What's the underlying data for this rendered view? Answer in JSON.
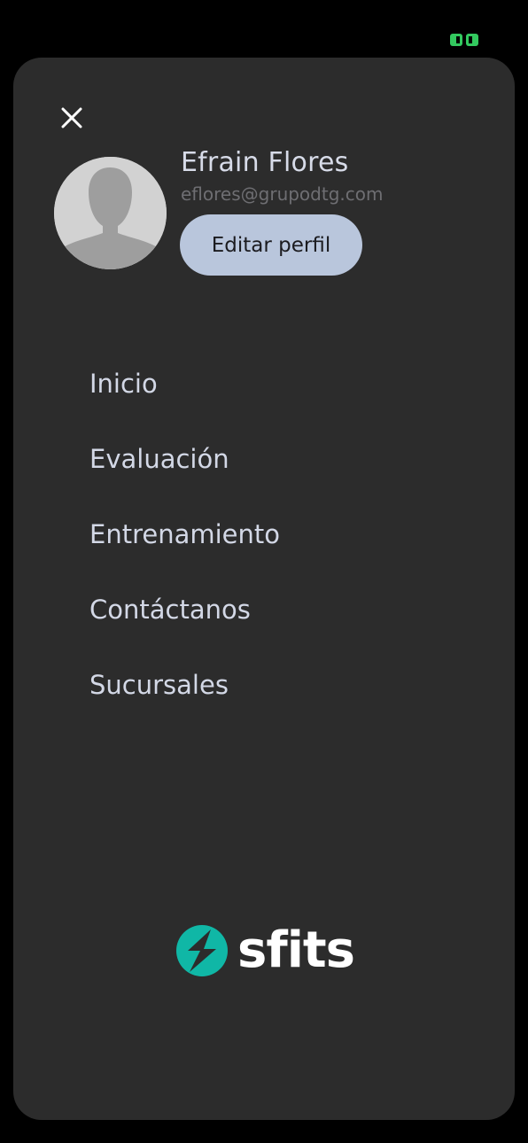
{
  "colors": {
    "background": "#000000",
    "drawer": "#2c2c2c",
    "button": "#b9c6dc",
    "brand_accent": "#10b7a6",
    "status_indicator": "#33c95f"
  },
  "header": {
    "close_icon": "close-icon"
  },
  "profile": {
    "avatar_icon": "user-silhouette-icon",
    "name": "Efrain Flores",
    "email": "eflores@grupodtg.com",
    "edit_label": "Editar perfil"
  },
  "menu": {
    "items": [
      {
        "label": "Inicio"
      },
      {
        "label": "Evaluación"
      },
      {
        "label": "Entrenamiento"
      },
      {
        "label": "Contáctanos"
      },
      {
        "label": "Sucursales"
      }
    ]
  },
  "brand": {
    "logo_icon": "sfits-logo-icon",
    "name": "sfits"
  }
}
